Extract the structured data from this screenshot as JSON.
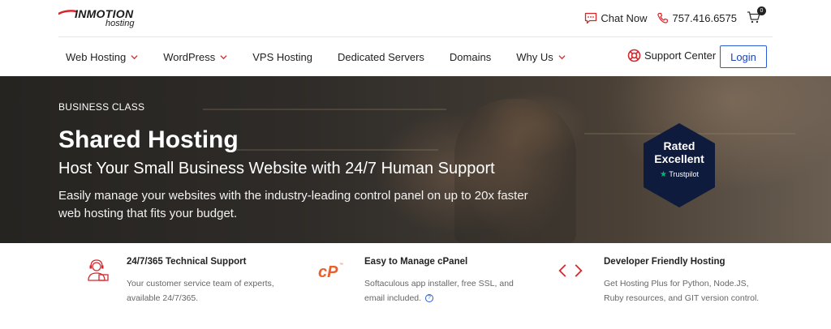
{
  "header": {
    "logo_brand": "INMOTION",
    "logo_sub": "hosting",
    "chat_label": "Chat Now",
    "phone": "757.416.6575",
    "cart_count": "0"
  },
  "nav": {
    "items": [
      {
        "label": "Web Hosting",
        "has_dropdown": true
      },
      {
        "label": "WordPress",
        "has_dropdown": true
      },
      {
        "label": "VPS Hosting",
        "has_dropdown": false
      },
      {
        "label": "Dedicated Servers",
        "has_dropdown": false
      },
      {
        "label": "Domains",
        "has_dropdown": false
      },
      {
        "label": "Why Us",
        "has_dropdown": true
      }
    ],
    "support_label": "Support Center",
    "login_label": "Login"
  },
  "hero": {
    "eyebrow": "BUSINESS CLASS",
    "title": "Shared Hosting",
    "subtitle": "Host Your Small Business Website with 24/7 Human Support",
    "description": "Easily manage your websites with the industry-leading control panel on up to 20x faster web hosting that fits your budget."
  },
  "badge": {
    "line1": "Rated",
    "line2": "Excellent",
    "provider": "Trustpilot"
  },
  "features": [
    {
      "icon": "support-agent-icon",
      "title": "24/7/365 Technical Support",
      "description": "Your customer service team of experts, available 24/7/365."
    },
    {
      "icon": "cpanel-icon",
      "title": "Easy to Manage cPanel",
      "description": "Softaculous app installer, free SSL, and email included."
    },
    {
      "icon": "code-brackets-icon",
      "title": "Developer Friendly Hosting",
      "description": "Get Hosting Plus for Python, Node.JS, Ruby resources, and GIT version control."
    }
  ],
  "colors": {
    "brand_red": "#d7262b",
    "login_blue": "#2d5bd3",
    "trustpilot_green": "#00b67a",
    "badge_navy": "#0f1b3d"
  }
}
